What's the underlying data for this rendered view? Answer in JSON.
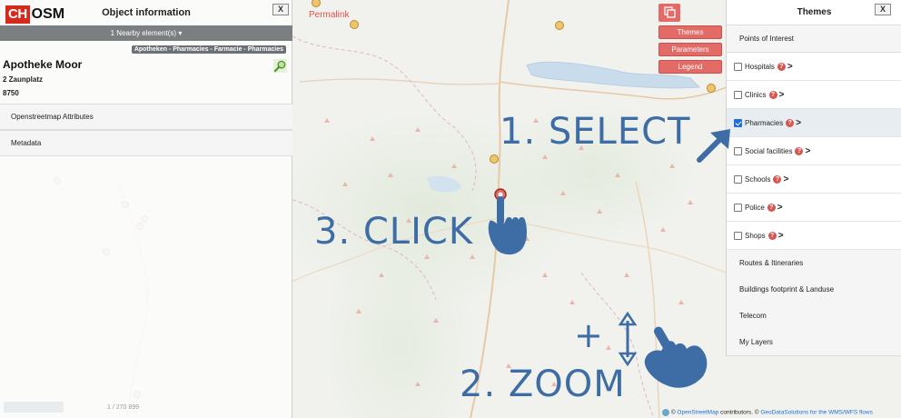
{
  "left_panel": {
    "logo_ch": "CH",
    "logo_osm": "OSM",
    "title": "Object information",
    "close_label": "X",
    "nearby": "1 Nearby element(s)",
    "category_tag": "Apotheken - Pharmacies - Farmacie - Pharmacies",
    "poi_name": "Apotheke Moor",
    "poi_address": "2 Zaunplatz",
    "poi_zip": "8750",
    "accordions": [
      "Openstreetmap Attributes",
      "Metadata"
    ],
    "scale": "1 / 270 899"
  },
  "map": {
    "permalink": "Permalink",
    "buttons": [
      "Themes",
      "Parameters",
      "Legend"
    ],
    "attribution_prefix": "©",
    "attribution_osm": "OpenStreetMap",
    "attribution_mid": "contributors. ©",
    "attribution_geo": "GeoDataSolutions for the WMS/WFS flows"
  },
  "right_panel": {
    "title": "Themes",
    "close_label": "X",
    "sections_top": "Points of Interest",
    "items": [
      {
        "label": "Hospitals",
        "checked": false
      },
      {
        "label": "Clinics",
        "checked": false
      },
      {
        "label": "Pharmacies",
        "checked": true
      },
      {
        "label": "Social facilities",
        "checked": false
      },
      {
        "label": "Schools",
        "checked": false
      },
      {
        "label": "Police",
        "checked": false
      },
      {
        "label": "Shops",
        "checked": false
      }
    ],
    "sections_bottom": [
      "Routes & Itineraries",
      "Buildings footprint & Landuse",
      "Telecom",
      "My Layers"
    ],
    "help_glyph": "?",
    "chevron_glyph": ">"
  },
  "annotations": {
    "select": "1. SELECT",
    "zoom": "2. ZOOM",
    "click": "3. CLICK",
    "plus": "+"
  },
  "colors": {
    "accent_red": "#e26b67",
    "annotation_blue": "#3e6da6",
    "selected_check": "#1d6fd9"
  }
}
